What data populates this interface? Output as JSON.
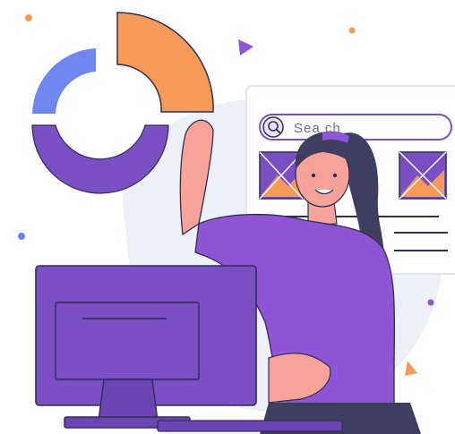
{
  "search": {
    "placeholder_text": "Sea ch",
    "icon": "magnifier-icon"
  },
  "colors": {
    "purple_primary": "#8f55d6",
    "purple_dark": "#6c45b5",
    "blue_donut": "#6d86f0",
    "orange_accent": "#f79a57",
    "skin": "#f7a39a",
    "hair": "#3e3e60",
    "background_blob": "#eef0f8",
    "outline": "#2f2f56"
  },
  "icons": {
    "donut_chart": "donut-chart-icon",
    "image_placeholder": "image-placeholder-icon",
    "play_triangle": "triangle-decor-icon",
    "monitor": "monitor-icon"
  }
}
